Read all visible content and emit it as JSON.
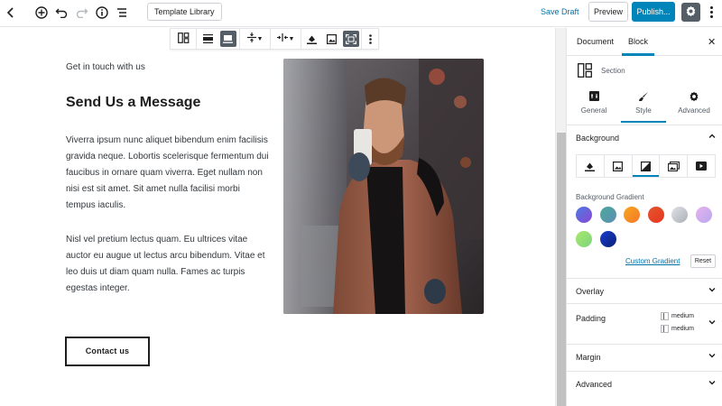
{
  "topbar": {
    "template_library": "Template Library",
    "save_draft": "Save Draft",
    "preview": "Preview",
    "publish": "Publish..."
  },
  "content": {
    "eyebrow": "Get in touch with us",
    "heading": "Send Us a Message",
    "paragraph1": "Viverra ipsum nunc aliquet bibendum enim facilisis gravida neque. Lobortis scelerisque fermentum dui faucibus in ornare quam viverra. Eget nullam non nisi est sit amet. Sit amet nulla facilisi morbi tempus iaculis.",
    "paragraph2": "Nisl vel pretium lectus quam. Eu ultrices vitae auctor eu augue ut lectus arcu bibendum. Vitae et leo duis ut diam quam nulla. Fames ac turpis egestas integer.",
    "contact_button": "Contact us"
  },
  "sidebar": {
    "tabs": [
      "Document",
      "Block"
    ],
    "active_tab": "Block",
    "block_name": "Section",
    "style_tabs": [
      "General",
      "Style",
      "Advanced"
    ],
    "active_style_tab": "Style",
    "background_title": "Background",
    "gradient_label": "Background Gradient",
    "gradients": [
      [
        "#4d7be0",
        "#8b46d6"
      ],
      [
        "#4aa89a",
        "#5f8fb5"
      ],
      [
        "#f6a81c",
        "#f7762b"
      ],
      [
        "#e2552e",
        "#e8361f"
      ],
      [
        "#dfe2e6",
        "#a9b0b7"
      ],
      [
        "#e6b3f0",
        "#b8a7ec"
      ],
      [
        "#a7e86b",
        "#7ed47e"
      ],
      [
        "#1a3fcf",
        "#0b1f78"
      ]
    ],
    "custom_gradient": "Custom Gradient",
    "reset": "Reset",
    "overlay": "Overlay",
    "padding": "Padding",
    "padding_values": [
      "medium",
      "medium"
    ],
    "margin": "Margin",
    "advanced": "Advanced"
  },
  "colors": {
    "accent": "#0085ba",
    "link": "#0073aa"
  }
}
